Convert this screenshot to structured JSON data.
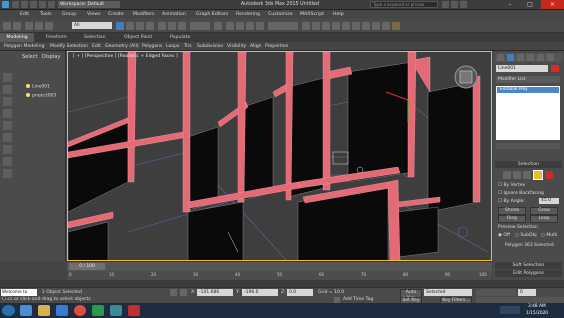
{
  "titlebar": {
    "workspace": "Workspace: Default",
    "title": "Autodesk 3ds Max 2015   Untitled",
    "search_placeholder": "Type a keyword or phrase",
    "undo_level": "All"
  },
  "menu": [
    "Edit",
    "Tools",
    "Group",
    "Views",
    "Create",
    "Modifiers",
    "Animation",
    "Graph Editors",
    "Rendering",
    "Customize",
    "MAXScript",
    "Help"
  ],
  "ribbon": {
    "tabs": [
      "Modeling",
      "Freeform",
      "Selection",
      "Object Paint",
      "Populate"
    ],
    "sub": [
      "Polygon Modeling",
      "Modify Selection",
      "Edit",
      "Geometry (All)",
      "Polygons",
      "Loops",
      "Tris",
      "Subdivision",
      "Visibility",
      "Align",
      "Properties"
    ]
  },
  "scene_explorer": {
    "tabs": [
      "Select",
      "Display"
    ],
    "items": [
      "Line001",
      "project003"
    ]
  },
  "viewport": {
    "label": "[ + ] [Perspective ] [Realistic + Edged Faces ]"
  },
  "command_panel": {
    "object_name": "Line001",
    "modifier_list": "Modifier List",
    "stack_item": "Editable Poly",
    "selection_title": "Selection",
    "by_vertex": "By Vertex",
    "ignore_backfacing": "Ignore Backfacing",
    "by_angle": "By Angle:",
    "by_angle_value": "45.0",
    "shrink": "Shrink",
    "grow": "Grow",
    "ring": "Ring",
    "loop": "Loop",
    "preview_selection": "Preview Selection",
    "off": "Off",
    "subobj": "SubObj",
    "multi": "Multi",
    "selected_info": "Polygon 363 Selected",
    "soft_selection": "Soft Selection",
    "edit_polygons": "Edit Polygons"
  },
  "timeline": {
    "frame": "0 / 100",
    "ticks": [
      "0",
      "10",
      "20",
      "30",
      "40",
      "50",
      "60",
      "70",
      "80",
      "90",
      "100"
    ]
  },
  "status": {
    "welcome": "Welcome to MAX",
    "selected": "1 Object Selected",
    "prompt": "Click or click-and-drag to select objects",
    "x_label": "X:",
    "x": "-141.686",
    "y_label": "Y:",
    "y": "-196.0",
    "z_label": "Z:",
    "z": "0.0",
    "grid": "Grid = 10.0",
    "add_time_tag": "Add Time Tag",
    "auto_key": "Auto Key",
    "selected_label": "Selected",
    "set_key": "Set Key",
    "key_filters": "Key Filters...",
    "frame_value": "0"
  },
  "taskbar": {
    "time": "3:48 AM",
    "date": "1/15/2020"
  }
}
